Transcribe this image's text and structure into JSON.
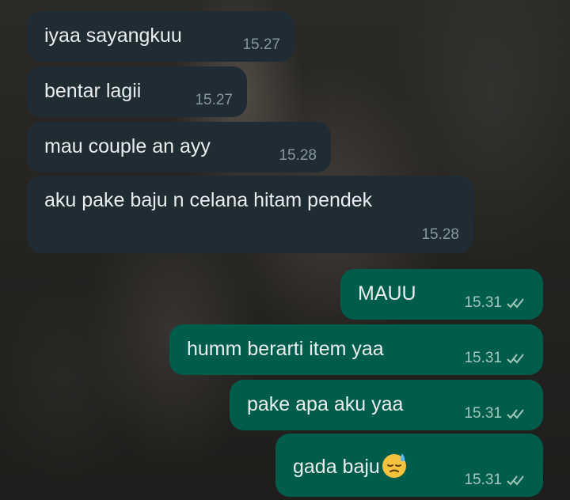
{
  "messages": [
    {
      "direction": "incoming",
      "text": "iyaa sayangkuu",
      "time": "15.27"
    },
    {
      "direction": "incoming",
      "text": "bentar lagii",
      "time": "15.27"
    },
    {
      "direction": "incoming",
      "text": "mau couple an ayy",
      "time": "15.28"
    },
    {
      "direction": "incoming",
      "text": "aku pake baju n celana hitam pendek",
      "time": "15.28"
    },
    {
      "direction": "outgoing",
      "text": "MAUU",
      "time": "15.31",
      "status": "double-check-icon"
    },
    {
      "direction": "outgoing",
      "text": "humm berarti item yaa",
      "time": "15.31",
      "status": "double-check-icon"
    },
    {
      "direction": "outgoing",
      "text": "pake apa aku yaa",
      "time": "15.31",
      "status": "double-check-icon"
    },
    {
      "direction": "outgoing",
      "text": "gada baju",
      "emoji": "sweat-face-emoji",
      "time": "15.31",
      "status": "double-check-icon"
    }
  ],
  "colors": {
    "incoming_bubble": "#1f2c33",
    "outgoing_bubble": "#005c4b",
    "text": "#e9edef",
    "meta": "#8696a0"
  }
}
